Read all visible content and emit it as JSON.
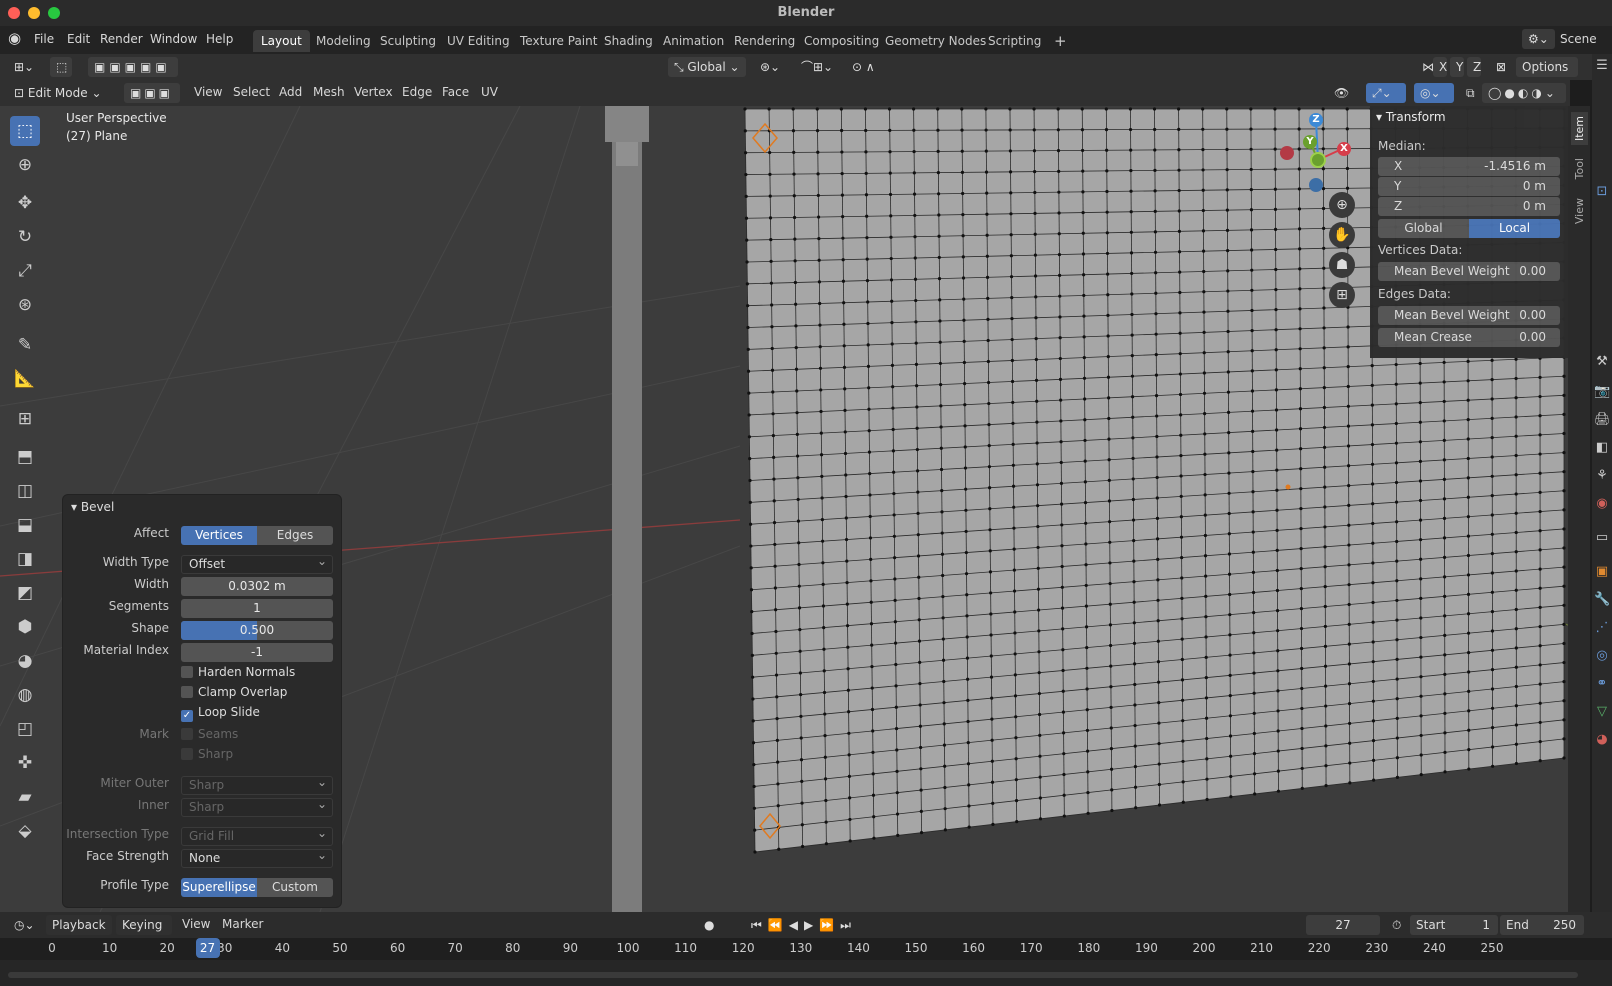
{
  "window": {
    "title": "Blender"
  },
  "menubar": {
    "items": [
      "File",
      "Edit",
      "Render",
      "Window",
      "Help"
    ]
  },
  "workspaces": [
    "Layout",
    "Modeling",
    "Sculpting",
    "UV Editing",
    "Texture Paint",
    "Shading",
    "Animation",
    "Rendering",
    "Compositing",
    "Geometry Nodes",
    "Scripting"
  ],
  "scene": {
    "label": "Scene"
  },
  "header1": {
    "orientation": "Global",
    "axes": [
      "X",
      "Y",
      "Z"
    ],
    "options": "Options"
  },
  "header2": {
    "mode": "Edit Mode",
    "menus": [
      "View",
      "Select",
      "Add",
      "Mesh",
      "Vertex",
      "Edge",
      "Face",
      "UV"
    ]
  },
  "viewport": {
    "view_name": "User Perspective",
    "object_name": "(27) Plane"
  },
  "gizmo": {
    "x": "X",
    "y": "Y",
    "z": "Z"
  },
  "sidebar_tabs": [
    "Item",
    "Tool",
    "View"
  ],
  "transform": {
    "title": "Transform",
    "median_label": "Median:",
    "x_label": "X",
    "x_value": "-1.4516 m",
    "y_label": "Y",
    "y_value": "0 m",
    "z_label": "Z",
    "z_value": "0 m",
    "global": "Global",
    "local": "Local",
    "vertices_data": "Vertices Data:",
    "v_bevel_label": "Mean Bevel Weight",
    "v_bevel_value": "0.00",
    "edges_data": "Edges Data:",
    "e_bevel_label": "Mean Bevel Weight",
    "e_bevel_value": "0.00",
    "crease_label": "Mean Crease",
    "crease_value": "0.00"
  },
  "bevel": {
    "title": "Bevel",
    "affect_label": "Affect",
    "affect_vertices": "Vertices",
    "affect_edges": "Edges",
    "width_type_label": "Width Type",
    "width_type": "Offset",
    "width_label": "Width",
    "width": "0.0302 m",
    "segments_label": "Segments",
    "segments": "1",
    "shape_label": "Shape",
    "shape": "0.500",
    "shape_fill": 0.5,
    "material_label": "Material Index",
    "material": "-1",
    "harden_normals": "Harden Normals",
    "clamp_overlap": "Clamp Overlap",
    "loop_slide": "Loop Slide",
    "mark_label": "Mark",
    "seams": "Seams",
    "sharp": "Sharp",
    "miter_outer_label": "Miter Outer",
    "miter_outer": "Sharp",
    "inner_label": "Inner",
    "inner": "Sharp",
    "intersection_label": "Intersection Type",
    "intersection": "Grid Fill",
    "face_strength_label": "Face Strength",
    "face_strength": "None",
    "profile_label": "Profile Type",
    "profile_super": "Superellipse",
    "profile_custom": "Custom"
  },
  "timeline": {
    "menus": [
      "Playback",
      "Keying",
      "View",
      "Marker"
    ],
    "current_frame": "27",
    "start_label": "Start",
    "start": "1",
    "end_label": "End",
    "end": "250",
    "ticks": [
      "0",
      "10",
      "20",
      "30",
      "40",
      "50",
      "60",
      "70",
      "80",
      "90",
      "100",
      "110",
      "120",
      "130",
      "140",
      "150",
      "160",
      "170",
      "180",
      "190",
      "200",
      "210",
      "220",
      "230",
      "240",
      "250"
    ]
  },
  "colors": {
    "accent": "#4772b3",
    "panel": "#2a2a2a",
    "viewport": "#3c3c3c"
  }
}
